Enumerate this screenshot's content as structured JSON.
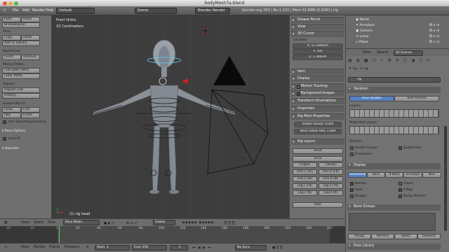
{
  "window": {
    "title": "bodyMesh7a.blend"
  },
  "infobar": {
    "menus": [
      "File",
      "Add",
      "Render",
      "Help"
    ],
    "screen": "Default",
    "scene": "Scene",
    "engine": "Blender Render",
    "stats": "blender.org 263 | Bo:1.333 | Mem:31.88M (0.00M) | rig"
  },
  "toolshelf": {
    "row1": [
      "Push",
      "Relax"
    ],
    "breakdowner": "Breakdowner",
    "pose_label": "Pose:",
    "copy_paste": [
      "Copy",
      "Paste"
    ],
    "add_library": "Add To Library",
    "keyframes_label": "Keyframes:",
    "insert_remove": [
      "Insert",
      "Remove"
    ],
    "motion_label": "Motion Paths:",
    "calc_paths": "Calculate Paths",
    "clear_paths": "Clear Paths",
    "repeat_label": "Repeat:",
    "repeat_last": "Repeat Last",
    "history": "History...",
    "grease_label": "Grease Pencil:",
    "draw_line": [
      "Draw",
      "Line"
    ],
    "poly_erase": [
      "Poly",
      "Erase"
    ],
    "sketch_sessions": "Use Sketching Sessions",
    "pose_options": "Pose Options",
    "auto_ik": "Auto IK",
    "operator": "Operator"
  },
  "viewport": {
    "view_name": "Front Ortho",
    "units": "10 Centimeters",
    "selection": "(1) rig head"
  },
  "npanel": {
    "grease_pencil": "Grease Pencil",
    "view": "View",
    "cursor": "3D Cursor",
    "location_label": "Location:",
    "loc_x": "X: 51.2066cm",
    "loc_y": "Y: -0m",
    "loc_z": "Z: 1.9463m",
    "item": "Item",
    "display": "Display",
    "motion_tracking": "Motion Tracking",
    "background_images": "Background Images",
    "transform_orientations": "Transform Orientations",
    "properties": "Properties",
    "rig_main": "Rig Main Properties",
    "isolate": "Isolate (head): 0.000",
    "neck_follow": "Neck Follow Hea: 1.000",
    "rig_layers": "Rig Layers",
    "layers": {
      "head": "Head",
      "torso": "Torso",
      "fingers": "Fingers",
      "tweak": "(Tweak)",
      "arm_l_fk": "Arm.L (FK)",
      "arm_r_fk": "Arm.R (FK)",
      "arm_l_ik": "Arm.L (IK)",
      "arm_r_ik": "Arm.R (IK)",
      "leg_l_fk": "Leg.L (FK)",
      "leg_r_fk": "Leg.R (FK)",
      "leg_l_ik": "Leg.L (IK)",
      "leg_r_ik": "Leg.R (IK)",
      "root": "Root"
    }
  },
  "outliner": {
    "items": [
      "World",
      "Armature",
      "Camera",
      "Lamp",
      "Plane"
    ],
    "menus": [
      "View",
      "Search"
    ],
    "filter": "All Scenes"
  },
  "props": {
    "breadcrumb": [
      "rig",
      "rig"
    ],
    "name": "rig",
    "skeleton": "Skeleton",
    "pose_position": "Pose Position",
    "rest_position": "Rest Position",
    "layers_label": "Layers:",
    "protected_label": "Protected Layers:",
    "deform_label": "Deform:",
    "vertex_groups": "Vertex Groups",
    "envelopes": "Envelopes",
    "quaternion": "Quaternion",
    "display": "Display",
    "display_types": [
      "Octahedral",
      "Stick",
      "B-Bone",
      "Envelope",
      "Wire"
    ],
    "names": "Names",
    "axes": "Axes",
    "shapes": "Shapes",
    "colors": "Colors",
    "xray": "X-Ray",
    "delay_refresh": "Delay Refresh",
    "bone_groups": "Bone Groups",
    "bg_buttons": [
      "Assign",
      "Remove",
      "Select",
      "Deselect"
    ],
    "pose_library": "Pose Library"
  },
  "viewheader": {
    "menus": [
      "View",
      "Select",
      "Pose"
    ],
    "mode": "Pose Mode",
    "orientation": "Global"
  },
  "timeline": {
    "ticks": [
      "-40",
      "-20",
      "0",
      "20",
      "40",
      "60",
      "80",
      "100",
      "120",
      "140",
      "160",
      "180",
      "200",
      "220",
      "240",
      "260"
    ],
    "menus": [
      "View",
      "Marker",
      "Frame",
      "Playback"
    ],
    "start": "Start: 1",
    "end": "End: 250",
    "current": "1",
    "sync": "No Sync"
  },
  "colors": {
    "accent": "#5680c2",
    "selected": "#4a74b8"
  }
}
